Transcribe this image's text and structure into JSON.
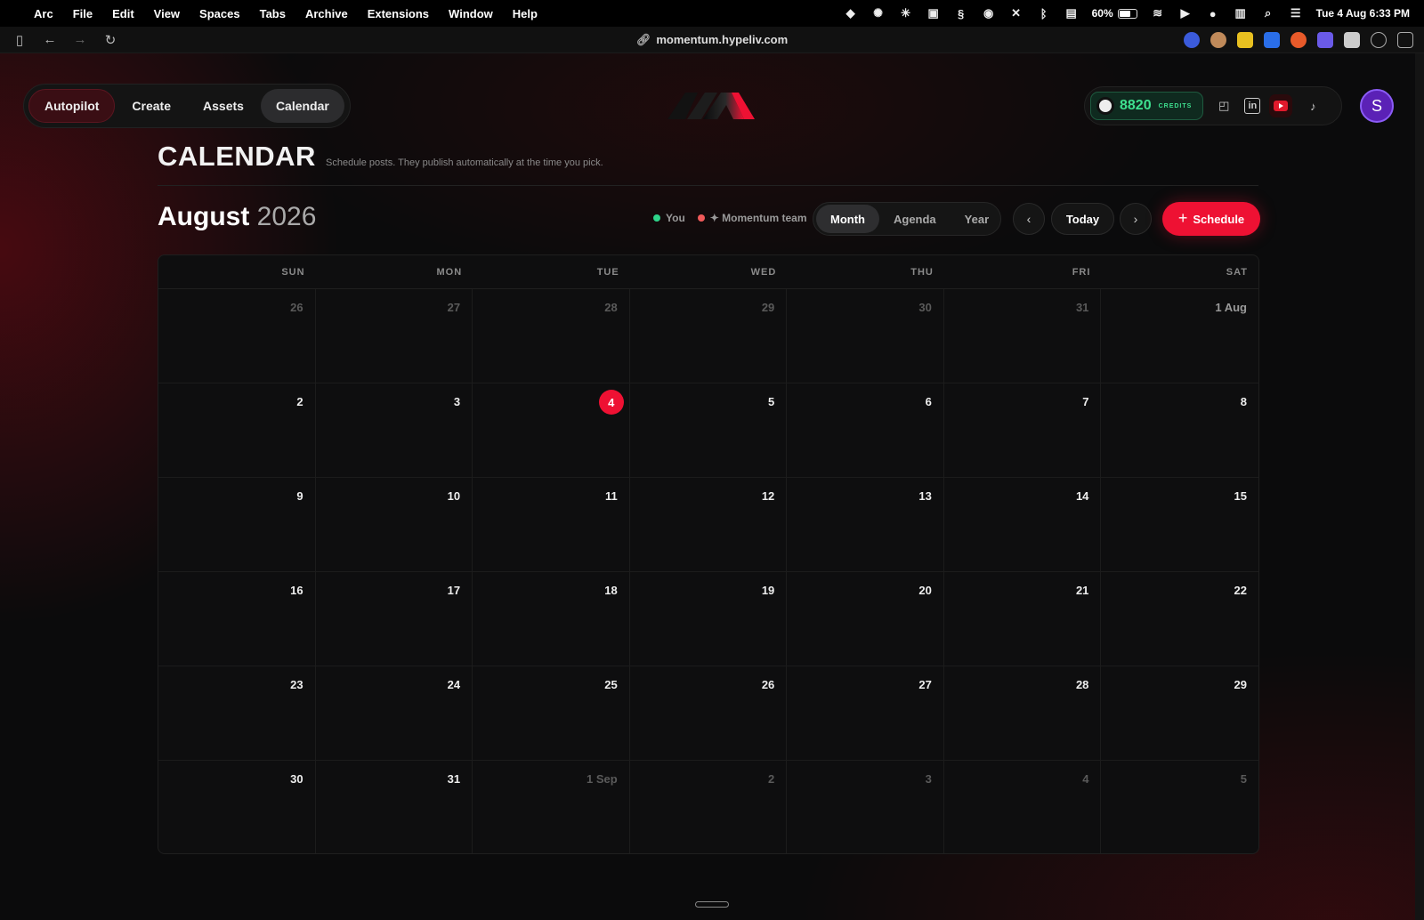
{
  "menubar": {
    "app": "Arc",
    "items": [
      "File",
      "Edit",
      "View",
      "Spaces",
      "Tabs",
      "Archive",
      "Extensions",
      "Window",
      "Help"
    ],
    "battery": "60%",
    "datetime": "Tue 4 Aug  6:33 PM"
  },
  "browser": {
    "url": "momentum.hypeliv.com"
  },
  "nav": {
    "items": [
      {
        "label": "Autopilot"
      },
      {
        "label": "Create"
      },
      {
        "label": "Assets"
      },
      {
        "label": "Calendar"
      }
    ],
    "active": "Calendar"
  },
  "account": {
    "credits": "8820",
    "credits_label": "CREDITS",
    "avatar_initial": "S"
  },
  "header": {
    "title": "CALENDAR",
    "subtitle": "Schedule posts. They publish automatically at the time you pick."
  },
  "calendar": {
    "month": "August",
    "year": "2026",
    "legend": [
      {
        "label": "You",
        "color": "#2ed48a"
      },
      {
        "label": "✦ Momentum team",
        "color": "#f05a5a"
      }
    ],
    "views": [
      "Month",
      "Agenda",
      "Year"
    ],
    "active_view": "Month",
    "today_label": "Today",
    "schedule_label": "Schedule",
    "weekdays": [
      "SUN",
      "MON",
      "TUE",
      "WED",
      "THU",
      "FRI",
      "SAT"
    ],
    "days": [
      {
        "label": "26",
        "muted": true
      },
      {
        "label": "27",
        "muted": true
      },
      {
        "label": "28",
        "muted": true
      },
      {
        "label": "29",
        "muted": true
      },
      {
        "label": "30",
        "muted": true
      },
      {
        "label": "31",
        "muted": true
      },
      {
        "label": "1 Aug",
        "muted": false,
        "dim": true
      },
      {
        "label": "2"
      },
      {
        "label": "3"
      },
      {
        "label": "4",
        "today": true
      },
      {
        "label": "5"
      },
      {
        "label": "6"
      },
      {
        "label": "7"
      },
      {
        "label": "8"
      },
      {
        "label": "9"
      },
      {
        "label": "10"
      },
      {
        "label": "11"
      },
      {
        "label": "12"
      },
      {
        "label": "13"
      },
      {
        "label": "14"
      },
      {
        "label": "15"
      },
      {
        "label": "16"
      },
      {
        "label": "17"
      },
      {
        "label": "18"
      },
      {
        "label": "19"
      },
      {
        "label": "20"
      },
      {
        "label": "21"
      },
      {
        "label": "22"
      },
      {
        "label": "23"
      },
      {
        "label": "24"
      },
      {
        "label": "25"
      },
      {
        "label": "26"
      },
      {
        "label": "27"
      },
      {
        "label": "28"
      },
      {
        "label": "29"
      },
      {
        "label": "30"
      },
      {
        "label": "31"
      },
      {
        "label": "1 Sep",
        "muted": true
      },
      {
        "label": "2",
        "muted": true
      },
      {
        "label": "3",
        "muted": true
      },
      {
        "label": "4",
        "muted": true
      },
      {
        "label": "5",
        "muted": true
      }
    ]
  },
  "colors": {
    "accent": "#ee1133",
    "credits_green": "#3ee08f",
    "avatar": "#5b21b6"
  }
}
